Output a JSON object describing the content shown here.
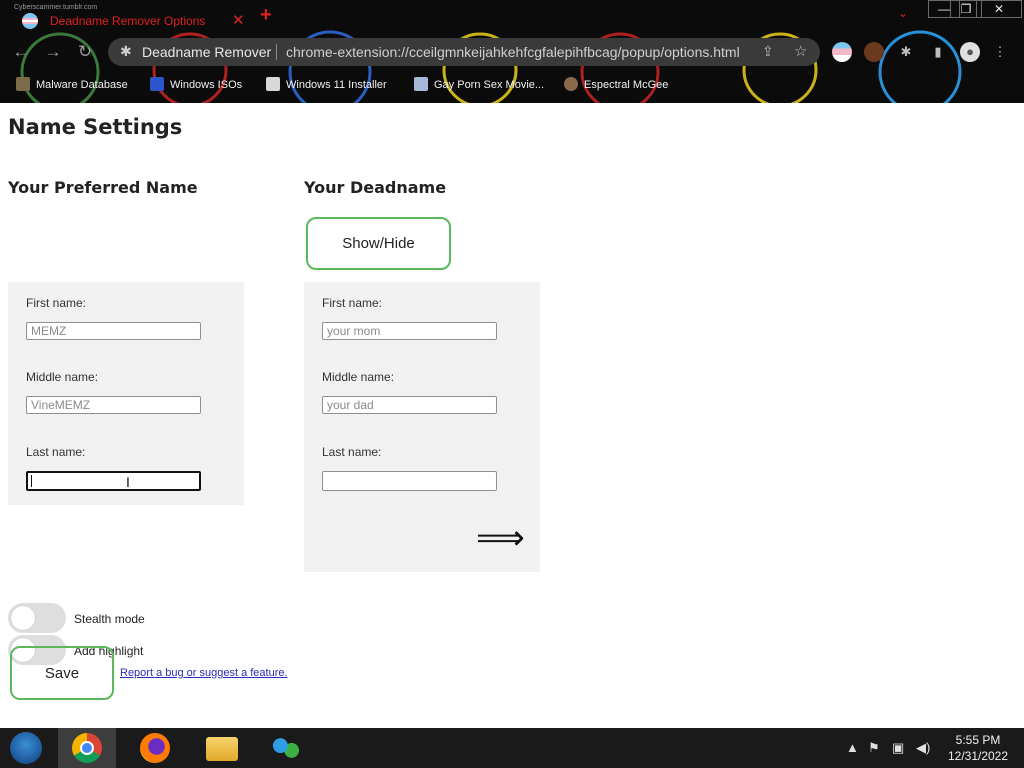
{
  "browser": {
    "tab_title": "Deadname Remover Options",
    "tab_tiny_text": "Cyberscammer.tumblr.com",
    "extension_name": "Deadname Remover",
    "url": "chrome-extension://cceilgmnkeijahkehfcgfalepihfbcag/popup/options.html",
    "window_controls": {
      "minimize": "—",
      "restore": "❐",
      "close": "✕"
    },
    "bookmarks": [
      {
        "label": "Malware Database",
        "icon": "person-icon"
      },
      {
        "label": "Windows ISOs",
        "icon": "x-icon"
      },
      {
        "label": "Windows 11 Installer",
        "icon": "image-icon"
      },
      {
        "label": "Gay Porn Sex Movie...",
        "icon": "site-icon"
      },
      {
        "label": "Espectral McGee",
        "icon": "avatar-icon"
      }
    ]
  },
  "page": {
    "title": "Name Settings",
    "preferred": {
      "heading": "Your Preferred Name",
      "first_label": "First name:",
      "first_value": "MEMZ",
      "middle_label": "Middle name:",
      "middle_value": "VineMEMZ",
      "last_label": "Last name:",
      "last_value": ""
    },
    "deadname": {
      "heading": "Your Deadname",
      "show_hide_label": "Show/Hide",
      "first_label": "First name:",
      "first_value": "your mom",
      "middle_label": "Middle name:",
      "middle_value": "your dad",
      "last_label": "Last name:",
      "last_value": "",
      "arrow_symbol": "⟹"
    },
    "stealth_label": "Stealth mode",
    "highlight_label": "Add highlight",
    "save_label": "Save",
    "report_link": "Report a bug or suggest a feature."
  },
  "taskbar": {
    "time": "5:55 PM",
    "date": "12/31/2022"
  },
  "colors": {
    "accent_green": "#5cb85c",
    "tab_red": "#e02020",
    "panel_gray": "#f1f1f1"
  }
}
